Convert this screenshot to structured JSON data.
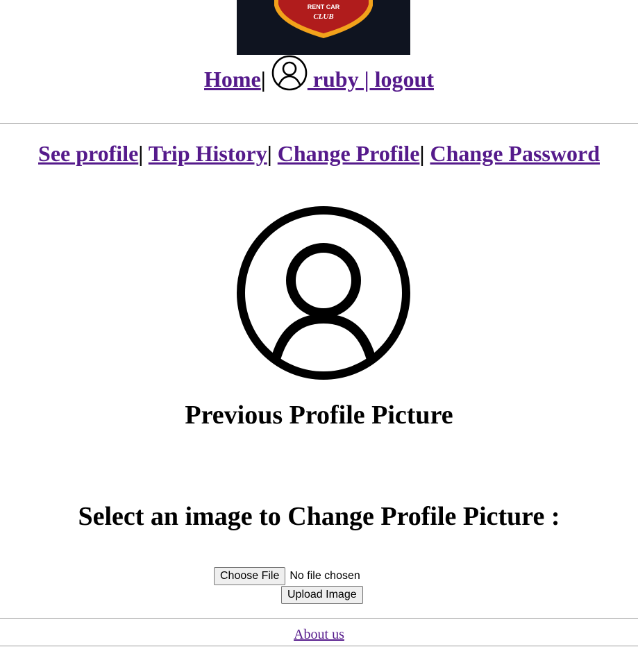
{
  "logo": {
    "text_line1": "RENT CAR",
    "text_line2": "CLUB",
    "colors": {
      "background": "#0f1420",
      "shield_fill": "#b01c1c",
      "shield_border": "#f2a21b"
    }
  },
  "topnav": {
    "home_label": "Home",
    "separator": "|",
    "user_label": " ruby | logout",
    "user_icon": "user-circle-icon"
  },
  "subnav": {
    "items": [
      {
        "label": "See profile"
      },
      {
        "label": "Trip History"
      },
      {
        "label": "Change Profile"
      },
      {
        "label": "Change Password"
      }
    ],
    "separator": "|"
  },
  "profile": {
    "icon": "user-circle-icon",
    "caption": "Previous Profile Picture"
  },
  "upload": {
    "heading": "Select an image to Change Profile Picture :",
    "choose_file_label": "Choose File",
    "file_status": "No file chosen",
    "upload_label": "Upload Image"
  },
  "footer": {
    "about_label": "About us"
  },
  "colors": {
    "link": "#551a8b",
    "divider": "#9a9a9a"
  }
}
